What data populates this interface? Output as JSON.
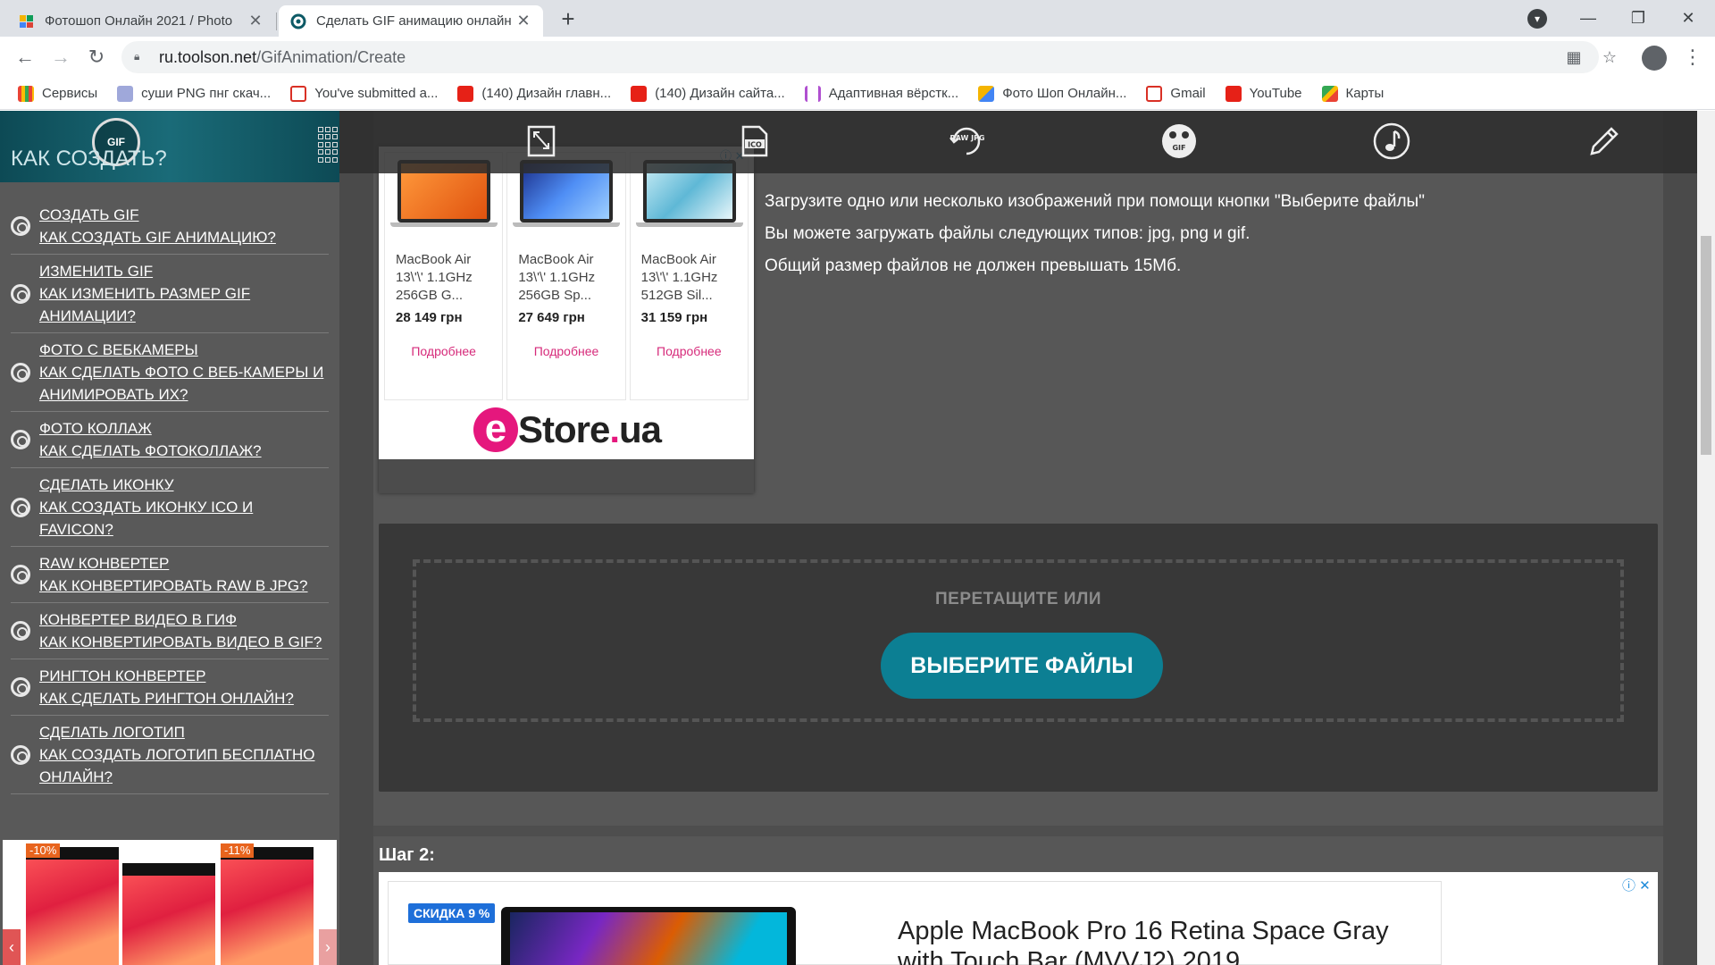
{
  "browser": {
    "tabs": [
      {
        "title": "Фотошоп Онлайн 2021 / Photo",
        "active": false
      },
      {
        "title": "Сделать GIF анимацию онлайн",
        "active": true
      }
    ],
    "url_domain": "ru.toolson.net",
    "url_path": "/GifAnimation/Create",
    "bookmarks": [
      {
        "label": "Сервисы",
        "icon": "apps-grid-icon"
      },
      {
        "label": "суши PNG пнг скач...",
        "icon": "png-icon"
      },
      {
        "label": "You've submitted a...",
        "icon": "gmail-icon"
      },
      {
        "label": "(140) Дизайн главн...",
        "icon": "youtube-icon"
      },
      {
        "label": "(140) Дизайн сайта...",
        "icon": "youtube-icon"
      },
      {
        "label": "Адаптивная вёрстк...",
        "icon": "html-icon"
      },
      {
        "label": "Фото Шоп Онлайн...",
        "icon": "photoshop-online-icon"
      },
      {
        "label": "Gmail",
        "icon": "gmail-icon"
      },
      {
        "label": "YouTube",
        "icon": "youtube-icon"
      },
      {
        "label": "Карты",
        "icon": "maps-icon"
      }
    ]
  },
  "sidebar": {
    "title": "КАК СОЗДАТЬ?",
    "logo_text": "GIF",
    "items": [
      {
        "line1": "СОЗДАТЬ GIF",
        "line2": "КАК СОЗДАТЬ GIF АНИМАЦИЮ?"
      },
      {
        "line1": "ИЗМЕНИТЬ GIF",
        "line2": "КАК ИЗМЕНИТЬ РАЗМЕР GIF АНИМАЦИИ?"
      },
      {
        "line1": "ФОТО С ВЕБКАМЕРЫ",
        "line2": "КАК СДЕЛАТЬ ФОТО С ВЕБ-КАМЕРЫ И АНИМИРОВАТЬ ИХ?"
      },
      {
        "line1": "ФОТО КОЛЛАЖ",
        "line2": "КАК СДЕЛАТЬ ФОТОКОЛЛАЖ?"
      },
      {
        "line1": "СДЕЛАТЬ ИКОНКУ",
        "line2": "КАК СОЗДАТЬ ИКОНКУ ICO И FAVICON?"
      },
      {
        "line1": "RAW КОНВЕРТЕР",
        "line2": "КАК КОНВЕРТИРОВАТЬ RAW В JPG?"
      },
      {
        "line1": "КОНВЕРТЕР ВИДЕО В ГИФ",
        "line2": "КАК КОНВЕРТИРОВАТЬ ВИДЕО В GIF?"
      },
      {
        "line1": "РИНГТОН КОНВЕРТЕР",
        "line2": "КАК СДЕЛАТЬ РИНГТОН ОНЛАЙН?"
      },
      {
        "line1": "СДЕЛАТЬ ЛОГОТИП",
        "line2": "КАК СОЗДАТЬ ЛОГОТИП БЕСПЛАТНО ОНЛАЙН?"
      }
    ],
    "ad_badges": [
      "-10%",
      "-11%"
    ]
  },
  "topnav": {
    "icons": [
      "resize-icon",
      "ico-icon",
      "raw-jpg-icon",
      "video-gif-icon",
      "music-note-icon",
      "pencil-icon"
    ],
    "ico_label": "ICO",
    "raw_label": "RAW JPG",
    "gif_label": "GIF"
  },
  "ad_products": {
    "items": [
      {
        "name": "MacBook Air 13\\'\\' 1.1GHz 256GB G...",
        "price": "28 149 грн",
        "more": "Подробнее",
        "screen_color": "#f07a2a"
      },
      {
        "name": "MacBook Air 13\\'\\' 1.1GHz 256GB Sp...",
        "price": "27 649 грн",
        "more": "Подробнее",
        "screen_color": "#2a5ad0"
      },
      {
        "name": "MacBook Air 13\\'\\' 1.1GHz 512GB Sil...",
        "price": "31 159 грн",
        "more": "Подробнее",
        "screen_color": "#7ec8e0"
      }
    ],
    "brand_e": "e",
    "brand_store": "Store",
    "brand_dot": ".",
    "brand_ua": "ua"
  },
  "instructions": [
    "Загрузите одно или несколько изображений при помощи кнопки \"Выберите файлы\"",
    "Вы можете загружать файлы следующих типов: jpg, png и gif.",
    "Общий размер файлов не должен превышать 15Мб."
  ],
  "upload": {
    "drag_text": "ПЕРЕТАЩИТЕ ИЛИ",
    "button_label": "ВЫБЕРИТЕ ФАЙЛЫ",
    "accent": "#0c7f93"
  },
  "step2": {
    "label": "Шаг 2:"
  },
  "bottom_ad": {
    "sale_badge": "СКИДКА 9 %",
    "headline": "Apple MacBook Pro 16 Retina Space Gray with Touch Bar (MVVJ2) 2019"
  }
}
